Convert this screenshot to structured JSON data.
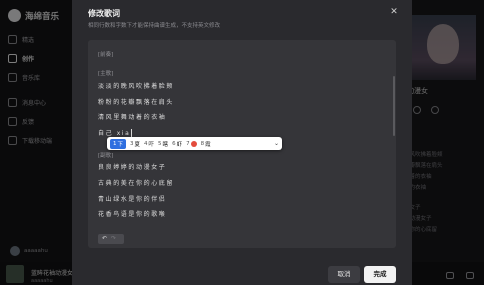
{
  "app": {
    "name": "海绵音乐"
  },
  "sidebar": {
    "items": [
      {
        "label": "精选",
        "icon": "home-icon"
      },
      {
        "label": "创作",
        "icon": "music-note-icon",
        "active": true
      },
      {
        "label": "音乐库",
        "icon": "library-icon"
      },
      {
        "label": "消息中心",
        "icon": "bell-icon"
      },
      {
        "label": "反馈",
        "icon": "feedback-icon"
      },
      {
        "label": "下载移动端",
        "icon": "phone-icon"
      }
    ],
    "user": {
      "name": "aaaaahu"
    }
  },
  "dialog": {
    "title": "修改歌词",
    "hint": "相同行数和字数下才能保持曲谱生成，不支持英文修改",
    "cancel_label": "取消",
    "done_label": "完成",
    "sections": {
      "prelude": "[前奏]",
      "verse": "[主歌]",
      "chorus": "[副歌]"
    },
    "lines": [
      "淡淡的晚风吹拂着脸颊",
      "粉粉的花瓣飘落在肩头",
      "清风里舞动着的衣袖",
      "古典的美在你的心底留",
      "青山绿水是你的伴侣",
      "花香鸟语是你的歌喉"
    ],
    "typing_line": "自己 xia",
    "chorus_first_line": "良良婷婷的动漫女子"
  },
  "ime": {
    "candidates": [
      {
        "num": "1",
        "text": "下",
        "selected": true
      },
      {
        "num": "3",
        "text": "夏"
      },
      {
        "num": "4",
        "text": "吓"
      },
      {
        "num": "5",
        "text": "瞎"
      },
      {
        "num": "6",
        "text": "虾"
      },
      {
        "num": "7",
        "text": ""
      },
      {
        "num": "8",
        "text": "霞"
      }
    ]
  },
  "right_panel": {
    "title": "动漫女",
    "lyrics": [
      "晚风吹拂着脸颊",
      "花瓣飘落在肩头",
      "动着的衣袖",
      "你的衣袖",
      "的女子",
      "的动漫女子",
      "在你的心底留"
    ]
  },
  "player": {
    "title": "蓝眸花袖动漫女"
  },
  "colors": {
    "accent": "#2f6fe0",
    "dialog_bg": "#2a2a2e",
    "editor_bg": "#353539"
  }
}
